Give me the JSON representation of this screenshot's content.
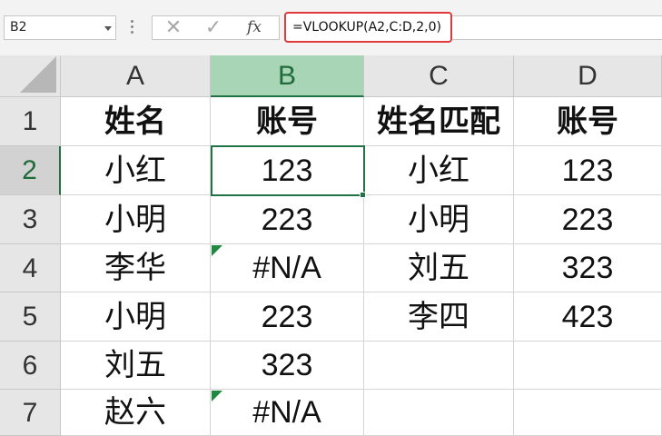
{
  "name_box": {
    "value": "B2",
    "dropdown_icon": "chevron-down-icon"
  },
  "formula_bar": {
    "cancel_icon": "✕",
    "enter_icon": "✓",
    "fx_label": "fx",
    "formula": "=VLOOKUP(A2,C:D,2,0)"
  },
  "sheet": {
    "columns": [
      "A",
      "B",
      "C",
      "D"
    ],
    "rows": [
      "1",
      "2",
      "3",
      "4",
      "5",
      "6",
      "7"
    ],
    "selected_cell": "B2",
    "cells": {
      "A1": "姓名",
      "B1": "账号",
      "C1": "姓名匹配",
      "D1": "账号",
      "A2": "小红",
      "B2": "123",
      "C2": "小红",
      "D2": "123",
      "A3": "小明",
      "B3": "223",
      "C3": "小明",
      "D3": "223",
      "A4": "李华",
      "B4": "#N/A",
      "C4": "刘五",
      "D4": "323",
      "A5": "小明",
      "B5": "223",
      "C5": "李四",
      "D5": "423",
      "A6": "刘五",
      "B6": "323",
      "C6": "",
      "D6": "",
      "A7": "赵六",
      "B7": "#N/A",
      "C7": "",
      "D7": ""
    },
    "colors": {
      "selection": "#217346",
      "selected_col_header": "#a7d5b5",
      "formula_highlight": "#e03a3a",
      "error_marker": "#1e8a3f"
    }
  }
}
